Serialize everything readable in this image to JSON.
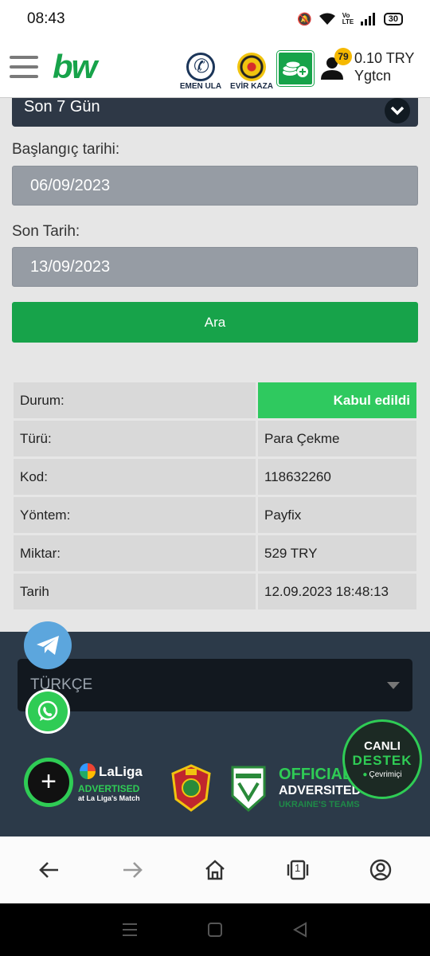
{
  "statusbar": {
    "time": "08:43",
    "network_label": "Vo LTE",
    "battery": "30"
  },
  "header": {
    "logo": "bw",
    "promo1_label": "EMEN ULA",
    "promo2_label": "EVİR KAZA",
    "notification_count": "79",
    "balance": "0.10 TRY",
    "username": "Ygtcn"
  },
  "form": {
    "period": "Son 7 Gün",
    "start_label": "Başlangıç tarihi:",
    "start_date": "06/09/2023",
    "end_label": "Son Tarih:",
    "end_date": "13/09/2023",
    "search_label": "Ara"
  },
  "details": [
    {
      "key": "Durum:",
      "value": "Kabul edildi"
    },
    {
      "key": "Türü:",
      "value": "Para Çekme"
    },
    {
      "key": "Kod:",
      "value": "118632260"
    },
    {
      "key": "Yöntem:",
      "value": "Payfix"
    },
    {
      "key": "Miktar:",
      "value": "529 TRY"
    },
    {
      "key": "Tarih",
      "value": "12.09.2023 18:48:13"
    }
  ],
  "footer": {
    "language": "TÜRKÇE",
    "laliga_name": "LaLiga",
    "laliga_advertised": "ADVERTISED",
    "laliga_match": "at La Liga's Match",
    "official_1": "OFFICIAL",
    "official_2": "ADVERSITED",
    "official_3": "UKRAINE'S TEAMS",
    "support_1": "CANLI",
    "support_2": "DESTEK",
    "support_3": "Çevrimiçi"
  },
  "browser": {
    "tab_count": "1"
  },
  "colors": {
    "brand_green": "#17a34a",
    "status_green": "#2fc95f",
    "footer_bg": "#2c3a49",
    "select_bg": "#2e3846"
  }
}
